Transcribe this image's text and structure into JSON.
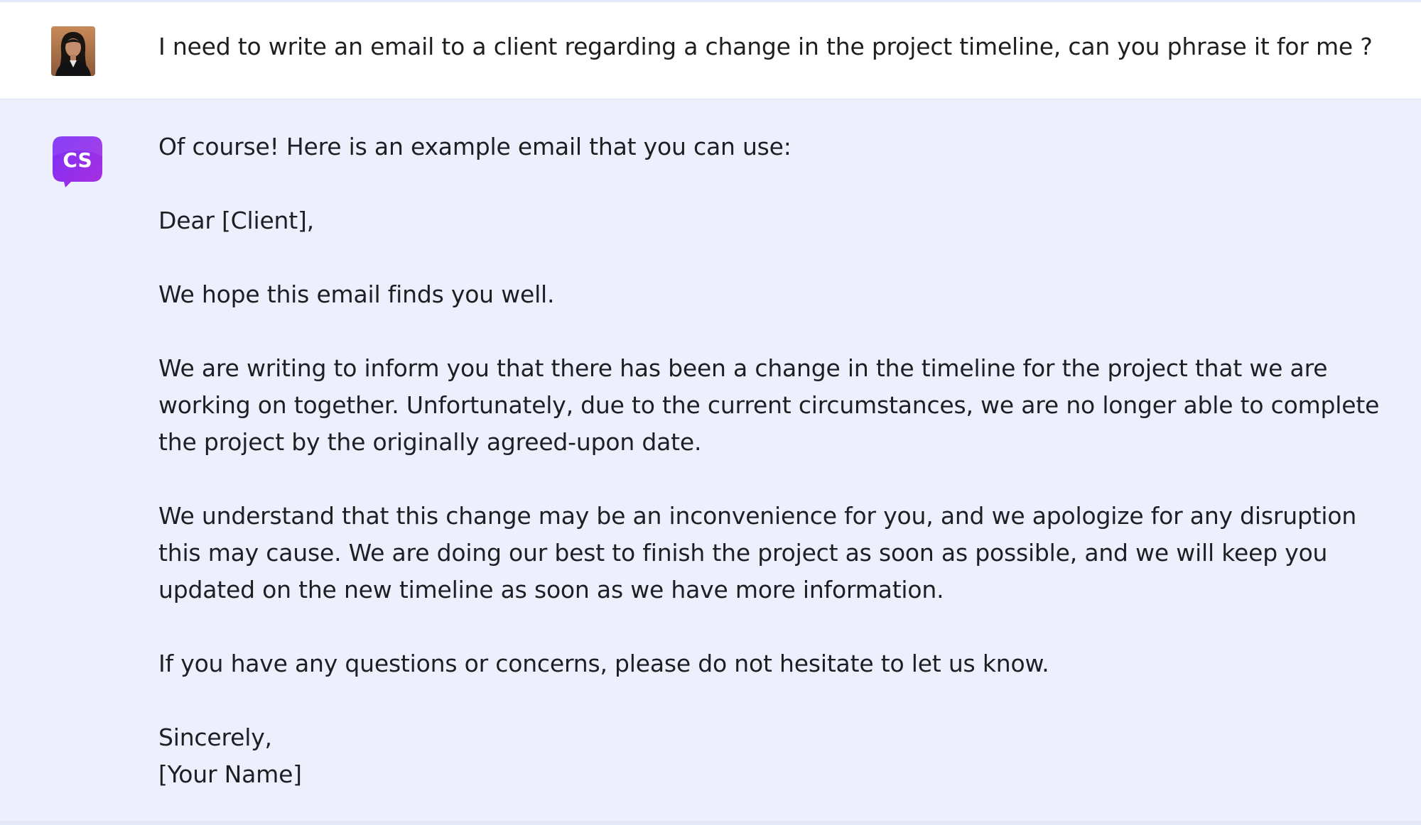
{
  "conversation": {
    "user_message": {
      "avatar_icon": "user-photo-avatar",
      "text": "I need to write an email to a client regarding a change in the project timeline, can you phrase it for me ?"
    },
    "assistant_message": {
      "avatar_icon": "cs-logo-icon",
      "avatar_label": "CS",
      "brand_colors": [
        "#6d2df5",
        "#a12de0"
      ],
      "intro": "Of course! Here is an example email that you can use:",
      "greeting": "Dear [Client],",
      "para1": "We hope this email finds you well.",
      "para2": "We are writing to inform you that there has been a change in the timeline for the project that we are working on together. Unfortunately, due to the current circumstances, we are no longer able to complete the project by the originally agreed-upon date.",
      "para3": "We understand that this change may be an inconvenience for you, and we apologize for any disruption this may cause. We are doing our best to finish the project as soon as possible, and we will keep you updated on the new timeline as soon as we have more information.",
      "para4": "If you have any questions or concerns, please do not hesitate to let us know.",
      "closing": "Sincerely,",
      "signature": "[Your Name]"
    }
  }
}
